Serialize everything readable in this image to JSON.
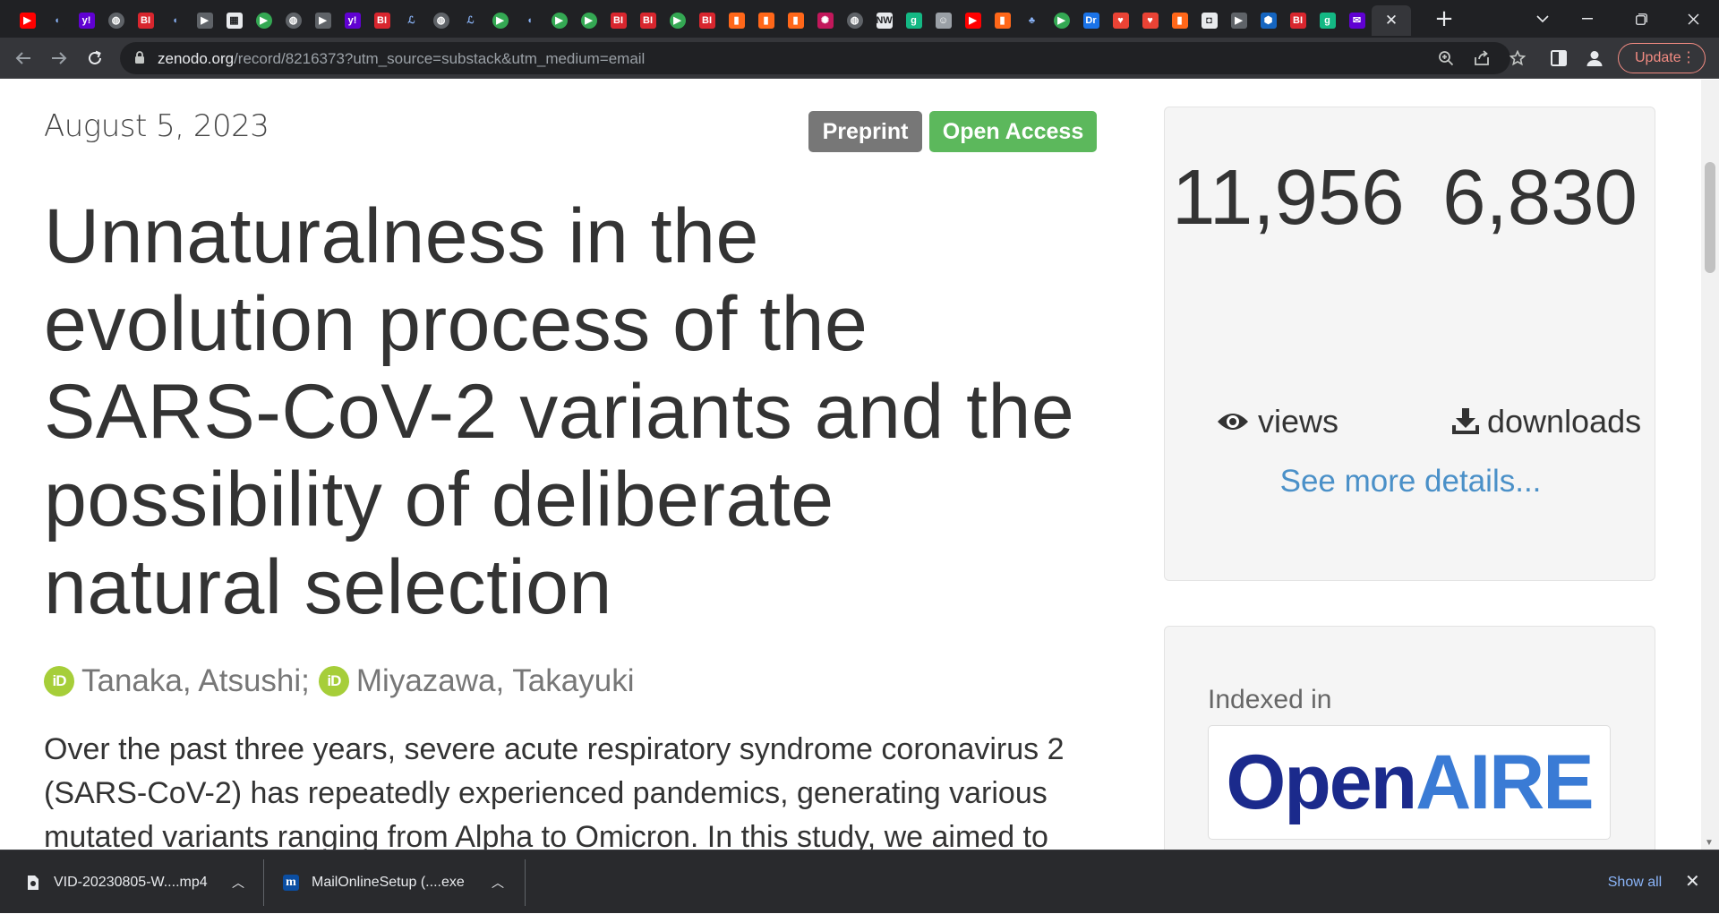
{
  "browser": {
    "tabs": [
      {
        "icon": "youtube-icon",
        "color": "#ff0000",
        "glyph": "▶",
        "shape": "square"
      },
      {
        "icon": "shield-icon",
        "color": "#202124",
        "glyph": "◖",
        "shape": "square"
      },
      {
        "icon": "yahoo-icon",
        "color": "#6001d2",
        "glyph": "y!",
        "shape": "square"
      },
      {
        "icon": "globe-icon",
        "color": "#5f6368",
        "glyph": "◍",
        "shape": "round"
      },
      {
        "icon": "bi-icon",
        "color": "#d8262e",
        "glyph": "BI",
        "shape": "square"
      },
      {
        "icon": "shield-icon",
        "color": "#202124",
        "glyph": "◖",
        "shape": "square"
      },
      {
        "icon": "arrow-tag-icon",
        "color": "#5f6368",
        "glyph": "▶",
        "shape": "square"
      },
      {
        "icon": "map-icon",
        "color": "#e8eaed",
        "glyph": "▦",
        "shape": "square"
      },
      {
        "icon": "play-icon",
        "color": "#34a853",
        "glyph": "▶",
        "shape": "round"
      },
      {
        "icon": "globe-icon",
        "color": "#5f6368",
        "glyph": "◍",
        "shape": "round"
      },
      {
        "icon": "arrow-tag-icon",
        "color": "#5f6368",
        "glyph": "▶",
        "shape": "square"
      },
      {
        "icon": "yahoo-icon",
        "color": "#6001d2",
        "glyph": "y!",
        "shape": "square"
      },
      {
        "icon": "bi-icon",
        "color": "#d8262e",
        "glyph": "BI",
        "shape": "square"
      },
      {
        "icon": "script-icon",
        "color": "#202124",
        "glyph": "ℒ",
        "shape": "square"
      },
      {
        "icon": "globe-icon",
        "color": "#5f6368",
        "glyph": "◍",
        "shape": "round"
      },
      {
        "icon": "script-icon",
        "color": "#202124",
        "glyph": "ℒ",
        "shape": "square"
      },
      {
        "icon": "play-icon",
        "color": "#34a853",
        "glyph": "▶",
        "shape": "round"
      },
      {
        "icon": "shield-icon",
        "color": "#202124",
        "glyph": "◖",
        "shape": "square"
      },
      {
        "icon": "play-icon",
        "color": "#34a853",
        "glyph": "▶",
        "shape": "round"
      },
      {
        "icon": "play-icon",
        "color": "#34a853",
        "glyph": "▶",
        "shape": "round"
      },
      {
        "icon": "bi-icon",
        "color": "#d8262e",
        "glyph": "BI",
        "shape": "square"
      },
      {
        "icon": "bi-icon",
        "color": "#d8262e",
        "glyph": "BI",
        "shape": "square"
      },
      {
        "icon": "play-icon",
        "color": "#34a853",
        "glyph": "▶",
        "shape": "round"
      },
      {
        "icon": "bi-icon",
        "color": "#d8262e",
        "glyph": "BI",
        "shape": "square"
      },
      {
        "icon": "bookmark-icon",
        "color": "#ff6719",
        "glyph": "▮",
        "shape": "square"
      },
      {
        "icon": "bookmark-icon",
        "color": "#ff6719",
        "glyph": "▮",
        "shape": "square"
      },
      {
        "icon": "bookmark-icon",
        "color": "#ff6719",
        "glyph": "▮",
        "shape": "square"
      },
      {
        "icon": "burst-icon",
        "color": "#c2185b",
        "glyph": "✺",
        "shape": "square"
      },
      {
        "icon": "globe-icon",
        "color": "#5f6368",
        "glyph": "◍",
        "shape": "round"
      },
      {
        "icon": "nw-icon",
        "color": "#e8eaed",
        "glyph": "NW",
        "shape": "square"
      },
      {
        "icon": "g-icon",
        "color": "#14b884",
        "glyph": "g",
        "shape": "square"
      },
      {
        "icon": "face-icon",
        "color": "#9aa0a6",
        "glyph": "☺",
        "shape": "square"
      },
      {
        "icon": "youtube-icon",
        "color": "#ff0000",
        "glyph": "▶",
        "shape": "square"
      },
      {
        "icon": "bookmark-icon",
        "color": "#ff6719",
        "glyph": "▮",
        "shape": "square"
      },
      {
        "icon": "bird-icon",
        "color": "#202124",
        "glyph": "♣",
        "shape": "square"
      },
      {
        "icon": "play-icon",
        "color": "#34a853",
        "glyph": "▶",
        "shape": "round"
      },
      {
        "icon": "dr-icon",
        "color": "#1a73e8",
        "glyph": "Dr",
        "shape": "square"
      },
      {
        "icon": "pin-icon",
        "color": "#ea4335",
        "glyph": "♥",
        "shape": "square"
      },
      {
        "icon": "pin-icon",
        "color": "#ea4335",
        "glyph": "♥",
        "shape": "square"
      },
      {
        "icon": "bookmark-icon",
        "color": "#ff6719",
        "glyph": "▮",
        "shape": "square"
      },
      {
        "icon": "newspaper-icon",
        "color": "#e8eaed",
        "glyph": "◘",
        "shape": "square"
      },
      {
        "icon": "arrow-tag-icon",
        "color": "#5f6368",
        "glyph": "▶",
        "shape": "square"
      },
      {
        "icon": "cube-icon",
        "color": "#1565c0",
        "glyph": "⬢",
        "shape": "square"
      },
      {
        "icon": "bi-icon",
        "color": "#d8262e",
        "glyph": "BI",
        "shape": "square"
      },
      {
        "icon": "g-icon",
        "color": "#14b884",
        "glyph": "g",
        "shape": "square"
      },
      {
        "icon": "mail-icon",
        "color": "#6001d2",
        "glyph": "✉",
        "shape": "square"
      }
    ],
    "active_tab_close": "✕",
    "new_tab_glyph": "+",
    "url_host": "zenodo.org",
    "url_path": "/record/8216373?utm_source=substack&utm_medium=email",
    "update_label": "Update"
  },
  "record": {
    "date": "August 5, 2023",
    "badges": {
      "preprint": "Preprint",
      "open_access": "Open Access"
    },
    "title": "Unnaturalness in the evolution process of the SARS-CoV-2 variants and the possibility of deliberate natural selection",
    "authors": [
      {
        "name": "Tanaka, Atsushi",
        "sep": ";"
      },
      {
        "name": "Miyazawa, Takayuki",
        "sep": ""
      }
    ],
    "orcid_label": "iD",
    "abstract": "Over the past three years, severe acute respiratory syndrome coronavirus 2 (SARS-CoV-2) has repeatedly experienced pandemics, generating various mutated variants ranging from Alpha to Omicron. In this study, we aimed to"
  },
  "stats": {
    "views": "11,956",
    "views_label": "views",
    "downloads": "6,830",
    "downloads_label": "downloads",
    "more_details": "See more details..."
  },
  "indexed": {
    "label": "Indexed in",
    "logo_open": "Open",
    "logo_aire": "AIRE"
  },
  "downloads_shelf": {
    "items": [
      {
        "name": "VID-20230805-W....mp4",
        "icon": "video-file-icon"
      },
      {
        "name": "MailOnlineSetup (....exe",
        "icon": "mailonline-app-icon"
      }
    ],
    "show_all": "Show all"
  },
  "colors": {
    "preprint_badge": "#777777",
    "open_access_badge": "#5cb85c",
    "link": "#4a90c8",
    "orcid": "#a6ce39",
    "openaire_dark": "#1b2a8c",
    "openaire_light": "#3a7bd5"
  }
}
